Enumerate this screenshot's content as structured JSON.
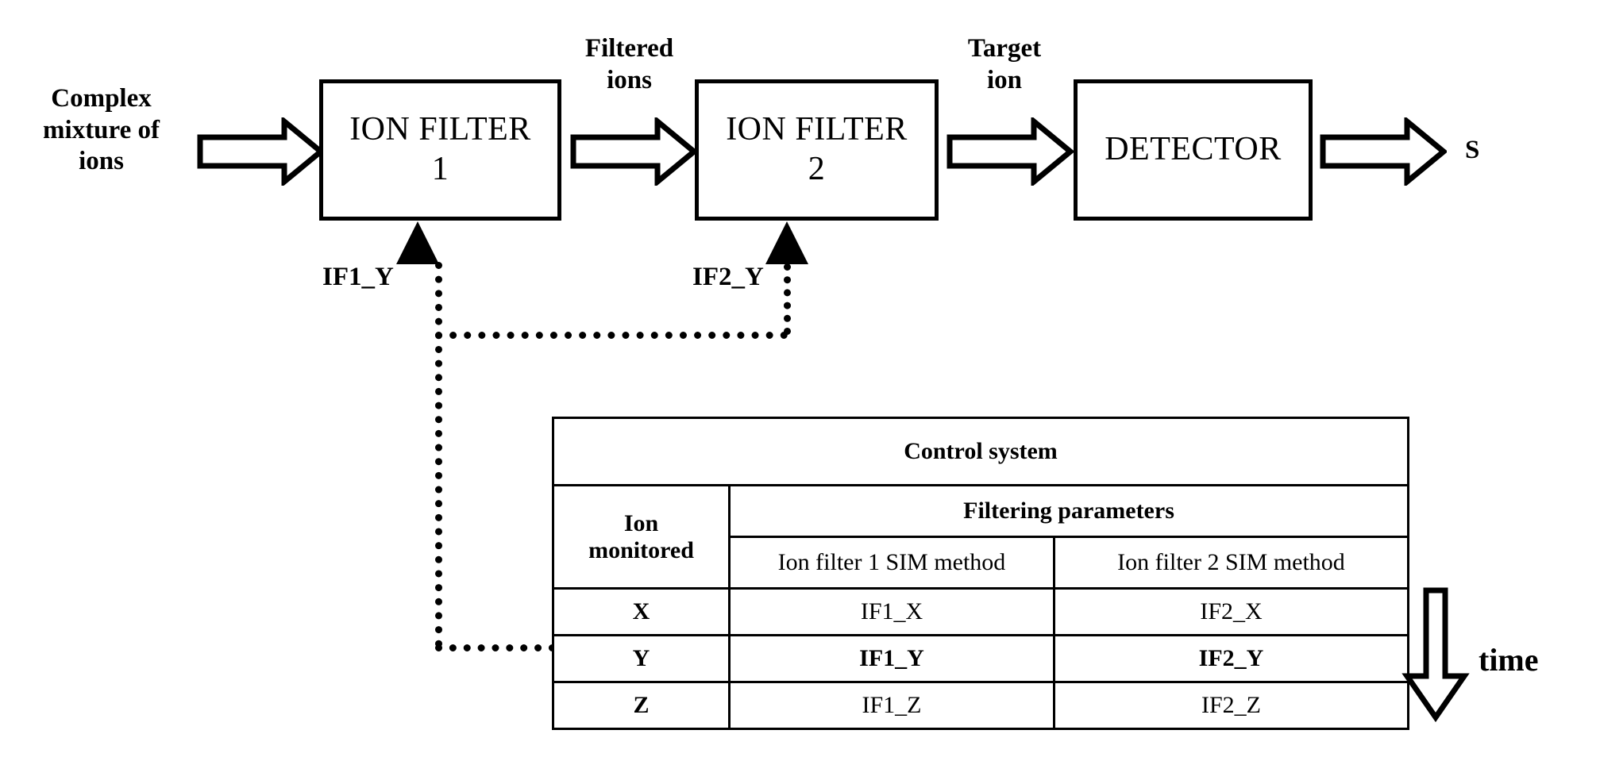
{
  "diagram": {
    "title": "Tandem ion filter mass spectrometry block diagram",
    "blocks": [
      {
        "id": "ion-filter-1",
        "line1": "ION FILTER",
        "line2": "1"
      },
      {
        "id": "ion-filter-2",
        "line1": "ION FILTER",
        "line2": "2"
      },
      {
        "id": "detector",
        "line1": "DETECTOR",
        "line2": ""
      }
    ],
    "flow_labels": {
      "input": "Complex\nmixture of\nions",
      "between_filters": "Filtered\nions",
      "before_detector": "Target\nion",
      "output": "S"
    },
    "feedback_labels": {
      "filter1": "IF1_Y",
      "filter2": "IF2_Y"
    },
    "time_label": "time"
  },
  "control_table": {
    "title": "Control system",
    "ion_column_header": "Ion\nmonitored",
    "group_header": "Filtering parameters",
    "sub_headers": [
      "Ion filter 1 SIM method",
      "Ion filter 2 SIM method"
    ],
    "rows": [
      {
        "ion": "X",
        "filter1": "IF1_X",
        "filter2": "IF2_X",
        "highlighted": false
      },
      {
        "ion": "Y",
        "filter1": "IF1_Y",
        "filter2": "IF2_Y",
        "highlighted": true
      },
      {
        "ion": "Z",
        "filter1": "IF1_Z",
        "filter2": "IF2_Z",
        "highlighted": false
      }
    ]
  },
  "colors": {
    "stroke": "#000000",
    "background": "#ffffff"
  }
}
